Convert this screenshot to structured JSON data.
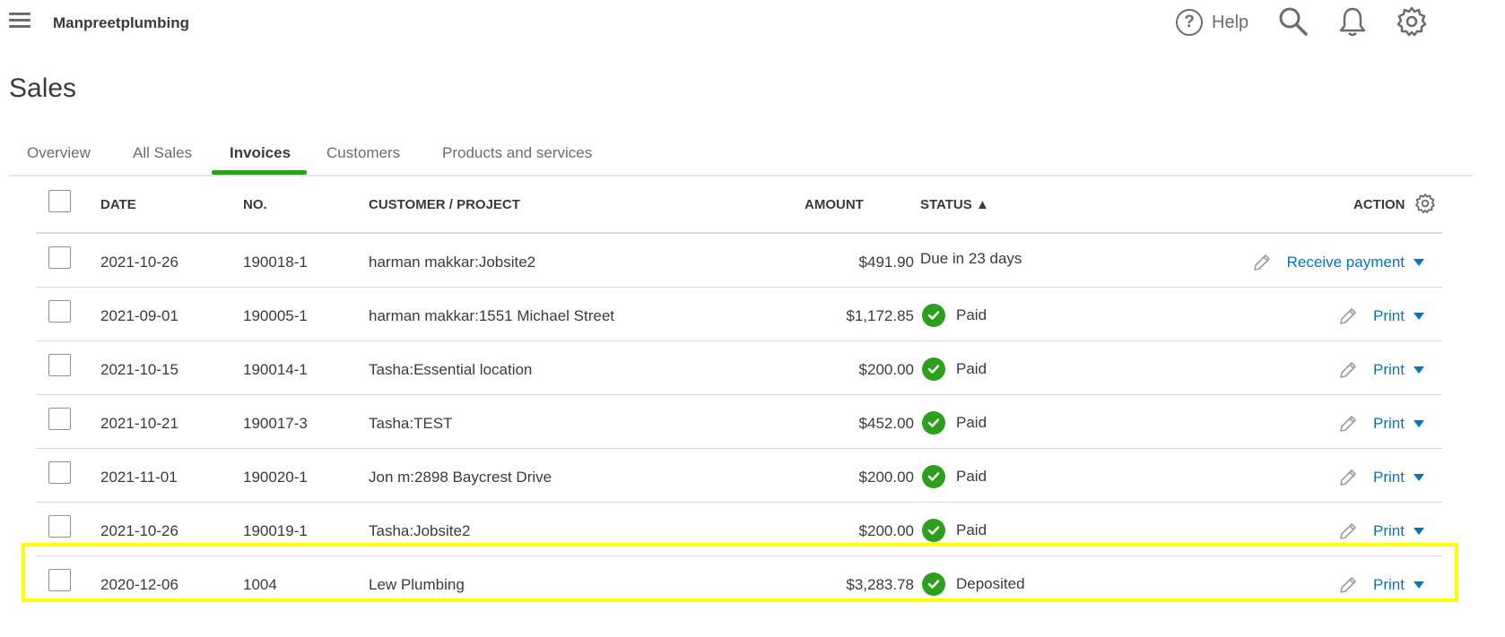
{
  "header": {
    "company_name": "Manpreetplumbing",
    "help_label": "Help",
    "help_glyph": "?",
    "icons": [
      "menu-icon",
      "help-icon",
      "search-icon",
      "bell-icon",
      "gear-icon"
    ]
  },
  "page": {
    "title": "Sales"
  },
  "tabs": [
    {
      "label": "Overview",
      "active": false
    },
    {
      "label": "All Sales",
      "active": false
    },
    {
      "label": "Invoices",
      "active": true
    },
    {
      "label": "Customers",
      "active": false
    },
    {
      "label": "Products and services",
      "active": false
    }
  ],
  "table": {
    "headers": {
      "date": "DATE",
      "no": "NO.",
      "customer": "CUSTOMER / PROJECT",
      "amount": "AMOUNT",
      "status": "STATUS ▲",
      "action": "ACTION"
    },
    "rows": [
      {
        "date": "2021-10-26",
        "no": "190018-1",
        "customer": "harman makkar:Jobsite2",
        "amount": "$491.90",
        "status": "Due in 23 days",
        "paid": false,
        "action": "Receive payment"
      },
      {
        "date": "2021-09-01",
        "no": "190005-1",
        "customer": "harman makkar:1551 Michael Street",
        "amount": "$1,172.85",
        "status": "Paid",
        "paid": true,
        "action": "Print"
      },
      {
        "date": "2021-10-15",
        "no": "190014-1",
        "customer": "Tasha:Essential location",
        "amount": "$200.00",
        "status": "Paid",
        "paid": true,
        "action": "Print"
      },
      {
        "date": "2021-10-21",
        "no": "190017-3",
        "customer": "Tasha:TEST",
        "amount": "$452.00",
        "status": "Paid",
        "paid": true,
        "action": "Print"
      },
      {
        "date": "2021-11-01",
        "no": "190020-1",
        "customer": "Jon m:2898 Baycrest Drive",
        "amount": "$200.00",
        "status": "Paid",
        "paid": true,
        "action": "Print"
      },
      {
        "date": "2021-10-26",
        "no": "190019-1",
        "customer": "Tasha:Jobsite2",
        "amount": "$200.00",
        "status": "Paid",
        "paid": true,
        "action": "Print"
      },
      {
        "date": "2020-12-06",
        "no": "1004",
        "customer": "Lew Plumbing",
        "amount": "$3,283.78",
        "status": "Deposited",
        "paid": true,
        "action": "Print"
      }
    ],
    "highlighted_row": 5
  },
  "colors": {
    "accent_green": "#2ca01c",
    "link_blue": "#0077c5",
    "highlight_yellow": "#ffff00",
    "text": "#393a3d"
  }
}
